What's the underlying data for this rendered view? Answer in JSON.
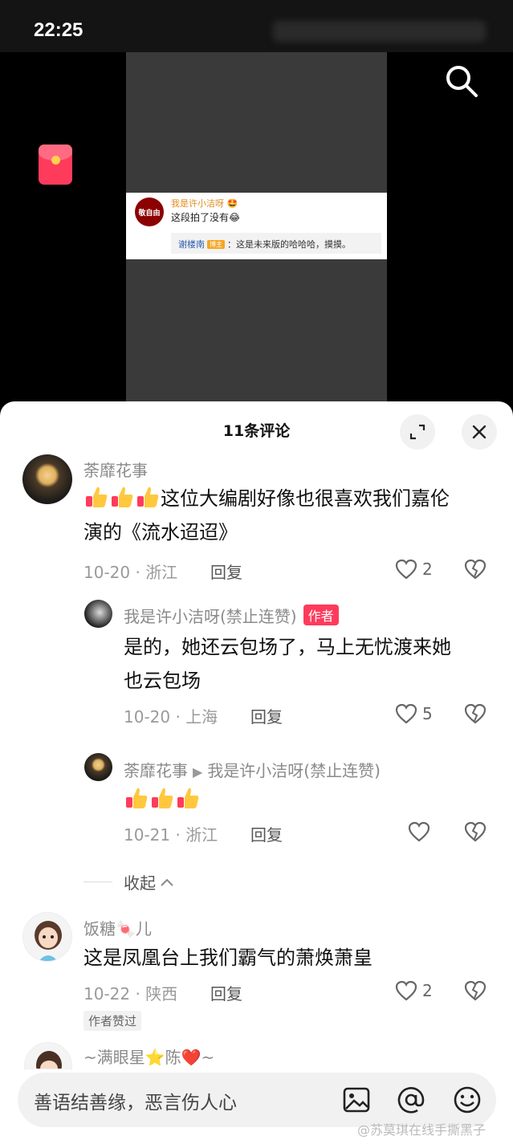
{
  "status": {
    "time": "22:25"
  },
  "embed": {
    "avatar_text": "敬自由",
    "author": "我是许小洁呀 🤩",
    "text": "这段拍了没有😂",
    "reply_name": "谢楼南",
    "reply_tag": "博主",
    "reply_text": "：这是未来版的哈哈哈，摸摸。"
  },
  "sheet": {
    "title": "11条评论"
  },
  "comments": [
    {
      "user": "荼靡花事",
      "text_line1": "这位大编剧好像也很喜欢我们嘉伦",
      "text_line2": "演的《流水迢迢》",
      "date_loc": "10-20 · 浙江",
      "reply": "回复",
      "likes": "2"
    },
    {
      "user": "我是许小洁呀(禁止连赞)",
      "badge": "作者",
      "text_line1": "是的，她还云包场了，马上无忧渡来她",
      "text_line2": "也云包场",
      "date_loc": "10-20 · 上海",
      "reply": "回复",
      "likes": "5"
    },
    {
      "user": "荼靡花事",
      "reply_to": "我是许小洁呀(禁止连赞)",
      "date_loc": "10-21 · 浙江",
      "reply": "回复"
    },
    {
      "user": "饭糖🍬儿",
      "text": "这是凤凰台上我们霸气的萧焕萧皇",
      "date_loc": "10-22 · 陕西",
      "reply": "回复",
      "likes": "2",
      "liked_tag": "作者赞过"
    },
    {
      "user": "~满眼星⭐陈❤️~"
    }
  ],
  "collapse": {
    "label": "收起"
  },
  "input": {
    "placeholder": "善语结善缘，恶言伤人心"
  },
  "watermark": "@苏莫琪在线手撕黑子"
}
